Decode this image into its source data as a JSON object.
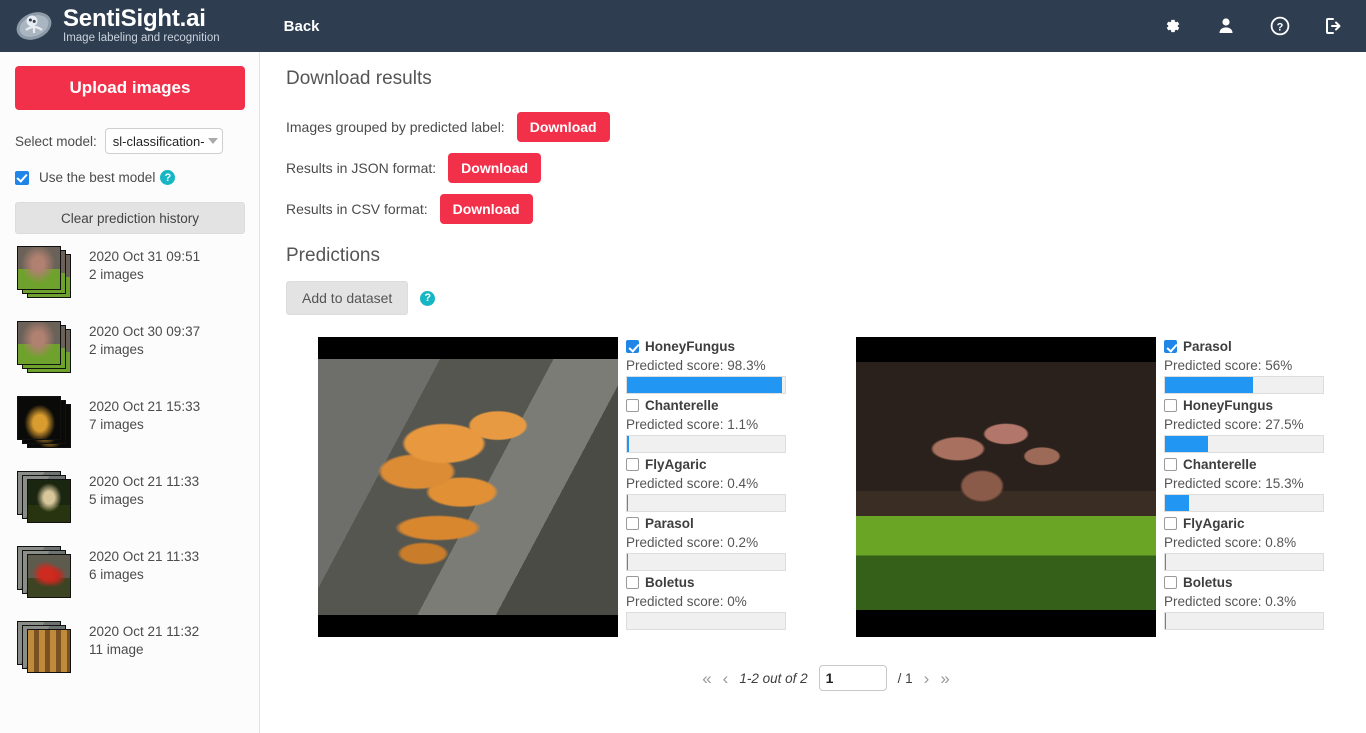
{
  "header": {
    "logo_title": "SentiSight.ai",
    "logo_subtitle": "Image labeling and recognition",
    "back_label": "Back",
    "icons": [
      {
        "name": "gear-icon",
        "title": "Settings"
      },
      {
        "name": "user-icon",
        "title": "Account"
      },
      {
        "name": "help-icon",
        "title": "Help"
      },
      {
        "name": "logout-icon",
        "title": "Log out"
      }
    ],
    "bg_color": "#2e3d50"
  },
  "sidebar": {
    "upload_label": "Upload images",
    "select_model_label": "Select model:",
    "selected_model": "sl-classification-...",
    "use_best_model_label": "Use the best model",
    "use_best_model_checked": true,
    "help_glyph": "?",
    "clear_history_label": "Clear prediction history",
    "history": [
      {
        "date": "2020 Oct 31 09:51",
        "count": "2 images",
        "art": "art-moss"
      },
      {
        "date": "2020 Oct 30 09:37",
        "count": "2 images",
        "art": "art-moss"
      },
      {
        "date": "2020 Oct 21 15:33",
        "count": "7 images",
        "art": "art-crab"
      },
      {
        "date": "2020 Oct 21 11:33",
        "count": "5 images",
        "art": "art-bol"
      },
      {
        "date": "2020 Oct 21 11:33",
        "count": "6 images",
        "art": "art-amanita"
      },
      {
        "date": "2020 Oct 21 11:32",
        "count": "11 image",
        "art": "art-logs"
      }
    ]
  },
  "main": {
    "download_section_title": "Download results",
    "downloads": [
      {
        "label": "Images grouped by predicted label:",
        "button": "Download"
      },
      {
        "label": "Results in JSON format:",
        "button": "Download"
      },
      {
        "label": "Results in CSV format:",
        "button": "Download"
      }
    ],
    "predictions_title": "Predictions",
    "add_to_dataset_label": "Add to dataset",
    "add_help_glyph": "?",
    "score_prefix": "Predicted score: ",
    "cards": [
      {
        "image_alt": "honey fungus cluster on tree bark",
        "photo_class": "photo-a",
        "labels": [
          {
            "name": "HoneyFungus",
            "score_text": "Predicted score: 98.3%",
            "value": 98.3,
            "checked": true
          },
          {
            "name": "Chanterelle",
            "score_text": "Predicted score: 1.1%",
            "value": 1.1,
            "checked": false
          },
          {
            "name": "FlyAgaric",
            "score_text": "Predicted score: 0.4%",
            "value": 0.4,
            "checked": false
          },
          {
            "name": "Parasol",
            "score_text": "Predicted score: 0.2%",
            "value": 0.2,
            "checked": false
          },
          {
            "name": "Boletus",
            "score_text": "Predicted score: 0%",
            "value": 0,
            "checked": false
          }
        ]
      },
      {
        "image_alt": "mushrooms growing on green moss",
        "photo_class": "photo-b",
        "labels": [
          {
            "name": "Parasol",
            "score_text": "Predicted score: 56%",
            "value": 56,
            "checked": true
          },
          {
            "name": "HoneyFungus",
            "score_text": "Predicted score: 27.5%",
            "value": 27.5,
            "checked": false
          },
          {
            "name": "Chanterelle",
            "score_text": "Predicted score: 15.3%",
            "value": 15.3,
            "checked": false
          },
          {
            "name": "FlyAgaric",
            "score_text": "Predicted score: 0.8%",
            "value": 0.8,
            "checked": false
          },
          {
            "name": "Boletus",
            "score_text": "Predicted score: 0.3%",
            "value": 0.3,
            "checked": false
          }
        ]
      }
    ],
    "pagination": {
      "first_glyph": "«",
      "prev_glyph": "‹",
      "info": "1-2 out of 2",
      "current_page": "1",
      "total_pages": "/ 1",
      "next_glyph": "›",
      "last_glyph": "»"
    }
  },
  "colors": {
    "accent_red": "#f2304a",
    "bar_blue": "#2196f3",
    "header_bg": "#2e3d50",
    "help_teal": "#17b6c4"
  }
}
